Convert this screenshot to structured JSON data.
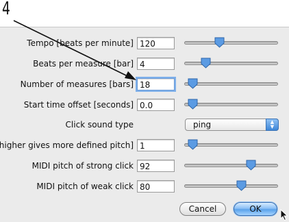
{
  "callout": {
    "number": "4"
  },
  "form": {
    "rows": [
      {
        "label": "Tempo [beats per minute]",
        "value": "120",
        "slider_fraction": 0.36
      },
      {
        "label": "Beats per measure [bar]",
        "value": "4",
        "slider_fraction": 0.2
      },
      {
        "label": "Number of measures [bars]",
        "value": "18",
        "slider_fraction": 0.04
      },
      {
        "label": "Start time offset [seconds]",
        "value": "0.0",
        "slider_fraction": 0.04
      },
      {
        "label": "higher gives more defined pitch]",
        "value": "1",
        "slider_fraction": 0.04
      },
      {
        "label": "MIDI pitch of strong click",
        "value": "92",
        "slider_fraction": 0.74
      },
      {
        "label": "MIDI pitch of weak click",
        "value": "80",
        "slider_fraction": 0.62
      }
    ],
    "click_sound": {
      "label": "Click sound type",
      "selected": "ping"
    }
  },
  "buttons": {
    "cancel": "Cancel",
    "ok": "OK"
  },
  "colors": {
    "panel": "#ebebeb",
    "focus_ring": "#7fb0ea",
    "ok_button": "#5aa2eb",
    "slider_thumb": "#3d86d8"
  }
}
